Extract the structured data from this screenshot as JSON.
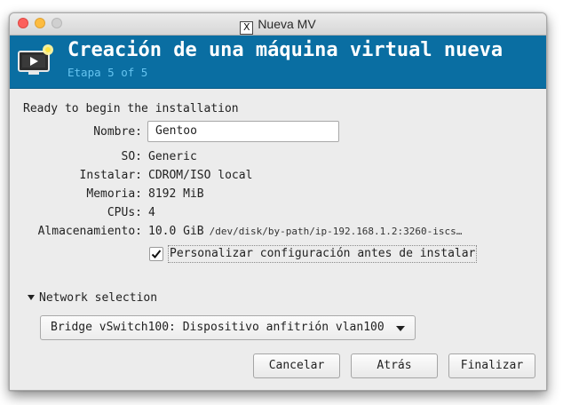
{
  "window": {
    "title": "Nueva MV"
  },
  "header": {
    "title": "Creación de una máquina virtual nueva",
    "step": "Etapa 5 of 5"
  },
  "content": {
    "ready_text": "Ready to begin the installation",
    "fields": {
      "name_label": "Nombre:",
      "name_value": "Gentoo",
      "os_label": "SO:",
      "os_value": "Generic",
      "install_label": "Instalar:",
      "install_value": "CDROM/ISO local",
      "memory_label": "Memoria:",
      "memory_value": "8192 MiB",
      "cpus_label": "CPUs:",
      "cpus_value": "4",
      "storage_label": "Almacenamiento:",
      "storage_size": "10.0 GiB",
      "storage_path": "/dev/disk/by-path/ip-192.168.1.2:3260-iscs…"
    },
    "customize_checkbox": {
      "label": "Personalizar configuración antes de instalar",
      "checked": true
    },
    "network": {
      "section_label": "Network selection",
      "selected": "Bridge vSwitch100: Dispositivo anfitrión vlan100"
    }
  },
  "buttons": {
    "cancel": "Cancelar",
    "back": "Atrás",
    "finish": "Finalizar"
  },
  "colors": {
    "header_bg": "#0a6ea2",
    "header_subtitle": "#66c4f0",
    "window_bg": "#ececec"
  },
  "icons": {
    "window_app": "x11-icon",
    "header": "monitor-play-icon"
  }
}
